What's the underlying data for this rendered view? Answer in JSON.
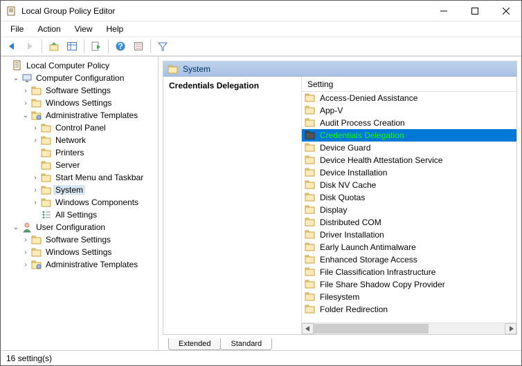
{
  "window": {
    "title": "Local Group Policy Editor"
  },
  "menu": {
    "file": "File",
    "action": "Action",
    "view": "View",
    "help": "Help"
  },
  "tree": {
    "root": {
      "label": "Local Computer Policy"
    },
    "cc": {
      "label": "Computer Configuration"
    },
    "cc_soft": {
      "label": "Software Settings"
    },
    "cc_win": {
      "label": "Windows Settings"
    },
    "cc_adm": {
      "label": "Administrative Templates"
    },
    "cc_adm_cp": {
      "label": "Control Panel"
    },
    "cc_adm_net": {
      "label": "Network"
    },
    "cc_adm_prn": {
      "label": "Printers"
    },
    "cc_adm_srv": {
      "label": "Server"
    },
    "cc_adm_start": {
      "label": "Start Menu and Taskbar"
    },
    "cc_adm_sys": {
      "label": "System"
    },
    "cc_adm_wc": {
      "label": "Windows Components"
    },
    "cc_adm_all": {
      "label": "All Settings"
    },
    "uc": {
      "label": "User Configuration"
    },
    "uc_soft": {
      "label": "Software Settings"
    },
    "uc_win": {
      "label": "Windows Settings"
    },
    "uc_adm": {
      "label": "Administrative Templates"
    }
  },
  "content": {
    "path_label": "System",
    "desc_title": "Credentials Delegation",
    "column_header": "Setting",
    "items": [
      {
        "label": "Access-Denied Assistance"
      },
      {
        "label": "App-V"
      },
      {
        "label": "Audit Process Creation"
      },
      {
        "label": "Credentials Delegation"
      },
      {
        "label": "Device Guard"
      },
      {
        "label": "Device Health Attestation Service"
      },
      {
        "label": "Device Installation"
      },
      {
        "label": "Disk NV Cache"
      },
      {
        "label": "Disk Quotas"
      },
      {
        "label": "Display"
      },
      {
        "label": "Distributed COM"
      },
      {
        "label": "Driver Installation"
      },
      {
        "label": "Early Launch Antimalware"
      },
      {
        "label": "Enhanced Storage Access"
      },
      {
        "label": "File Classification Infrastructure"
      },
      {
        "label": "File Share Shadow Copy Provider"
      },
      {
        "label": "Filesystem"
      },
      {
        "label": "Folder Redirection"
      }
    ],
    "selected_index": 3
  },
  "tabs": {
    "extended": "Extended",
    "standard": "Standard"
  },
  "status": {
    "text": "16 setting(s)"
  }
}
